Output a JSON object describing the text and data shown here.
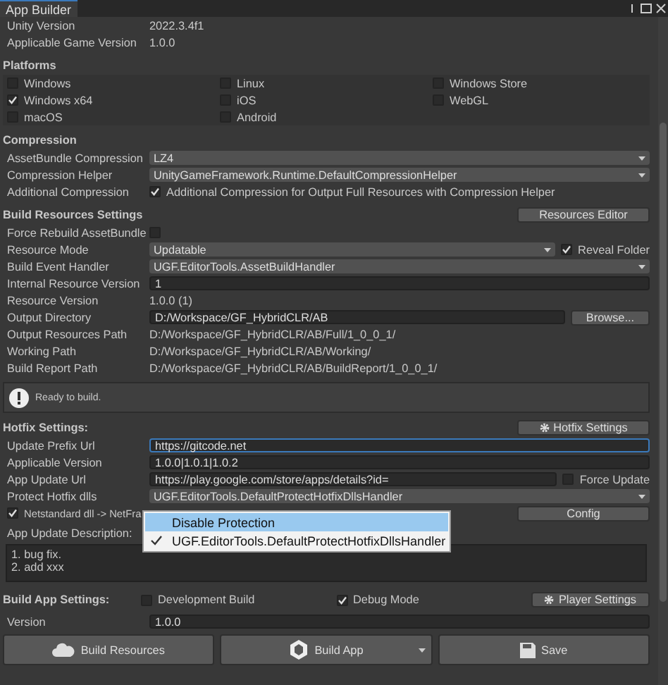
{
  "window": {
    "title": "App Builder"
  },
  "header_fields": [
    {
      "label": "Unity Version",
      "value": "2022.3.4f1"
    },
    {
      "label": "Applicable Game Version",
      "value": "1.0.0"
    }
  ],
  "platforms": {
    "title": "Platforms",
    "items": [
      {
        "label": "Windows",
        "checked": false
      },
      {
        "label": "Linux",
        "checked": false
      },
      {
        "label": "Windows Store",
        "checked": false
      },
      {
        "label": "Windows x64",
        "checked": true
      },
      {
        "label": "iOS",
        "checked": false
      },
      {
        "label": "WebGL",
        "checked": false
      },
      {
        "label": "macOS",
        "checked": false
      },
      {
        "label": "Android",
        "checked": false
      }
    ]
  },
  "compression": {
    "title": "Compression",
    "rows": [
      {
        "kind": "dropdown",
        "label": "AssetBundle Compression",
        "value": "LZ4"
      },
      {
        "kind": "dropdown",
        "label": "Compression Helper",
        "value": "UnityGameFramework.Runtime.DefaultCompressionHelper"
      },
      {
        "kind": "checkbox",
        "label": "Additional Compression",
        "text": "Additional Compression for Output Full Resources with Compression Helper",
        "checked": true
      }
    ]
  },
  "build_resources": {
    "title": "Build Resources Settings",
    "button": "Resources Editor",
    "rows": [
      {
        "kind": "checkbox",
        "label": "Force Rebuild AssetBundle",
        "checked": false
      },
      {
        "kind": "dropdown",
        "label": "Resource Mode",
        "value": "Updatable",
        "toggle": {
          "label": "Reveal Folder",
          "checked": true
        }
      },
      {
        "kind": "dropdown",
        "label": "Build Event Handler",
        "value": "UGF.EditorTools.AssetBuildHandler"
      },
      {
        "kind": "field",
        "label": "Internal Resource Version",
        "value": "1"
      },
      {
        "kind": "text",
        "label": "Resource Version",
        "value": "1.0.0 (1)"
      },
      {
        "kind": "field",
        "label": "Output Directory",
        "value": "D:/Workspace/GF_HybridCLR/AB",
        "button": "Browse..."
      },
      {
        "kind": "text",
        "label": "Output Resources Path",
        "value": "D:/Workspace/GF_HybridCLR/AB/Full/1_0_0_1/"
      },
      {
        "kind": "text",
        "label": "Working Path",
        "value": "D:/Workspace/GF_HybridCLR/AB/Working/"
      },
      {
        "kind": "text",
        "label": "Build Report Path",
        "value": "D:/Workspace/GF_HybridCLR/AB/BuildReport/1_0_0_1/"
      }
    ]
  },
  "message": "Ready to build.",
  "hotfix": {
    "title": "Hotfix Settings:",
    "button": "Hotfix Settings",
    "rows": [
      {
        "kind": "field",
        "label": "Update Prefix Url",
        "value": "https://gitcode.net",
        "focused": true
      },
      {
        "kind": "field",
        "label": "Applicable Version",
        "value": "1.0.0|1.0.1|1.0.2",
        "focused": false
      },
      {
        "kind": "field",
        "label": "App Update Url",
        "value": "https://play.google.com/store/apps/details?id=",
        "focused": false,
        "toggle": {
          "label": "Force Update",
          "checked": false
        }
      },
      {
        "kind": "dropdown",
        "label": "Protect Hotfix dlls",
        "value": "UGF.EditorTools.DefaultProtectHotfixDllsHandler"
      }
    ],
    "netstandard": {
      "label": "Netstandard dll -> NetFra",
      "checked": true
    },
    "config_button": "Config",
    "description": {
      "label": "App Update Description:",
      "value": "1. bug fix.\n2. add xxx"
    }
  },
  "popup": {
    "items": [
      {
        "label": "Disable Protection",
        "highlighted": true,
        "checked": false
      },
      {
        "label": "UGF.EditorTools.DefaultProtectHotfixDllsHandler",
        "highlighted": false,
        "checked": true
      }
    ]
  },
  "build_app": {
    "title": "Build App Settings:",
    "toggles": [
      {
        "label": "Development Build",
        "checked": false
      },
      {
        "label": "Debug Mode",
        "checked": true
      }
    ],
    "button": "Player Settings",
    "version": {
      "label": "Version",
      "value": "1.0.0"
    }
  },
  "actions": [
    {
      "kind": "cloud",
      "label": "Build Resources"
    },
    {
      "kind": "unity",
      "label": "Build App",
      "dropdown": true
    },
    {
      "kind": "save",
      "label": "Save"
    }
  ]
}
